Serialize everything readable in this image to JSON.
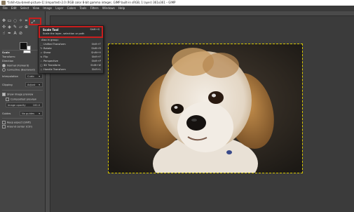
{
  "window": {
    "title": "*[shih-tzu-breed-picture-1] (imported)-2.0 (RGB color 8-bit gamma integer, GIMP built-in sRGB, 1 layer) 361x361 – GIMP"
  },
  "menubar": [
    "File",
    "Edit",
    "Select",
    "View",
    "Image",
    "Layer",
    "Colors",
    "Tools",
    "Filters",
    "Windows",
    "Help"
  ],
  "tool_popup": {
    "title": "Scale Tool",
    "shortcut": "Shift+S",
    "description": "Scale the layer, selection or path",
    "group_label": "Also in group:",
    "items": [
      {
        "icon": "unified-transform-icon",
        "label": "Unified Transform",
        "shortcut": "Shift+T"
      },
      {
        "icon": "rotate-icon",
        "label": "Rotate",
        "shortcut": "Shift+R"
      },
      {
        "icon": "shear-icon",
        "label": "Shear",
        "shortcut": "Shift+H"
      },
      {
        "icon": "flip-icon",
        "label": "Flip",
        "shortcut": "Shift+F"
      },
      {
        "icon": "perspective-icon",
        "label": "Perspective",
        "shortcut": "Shift+P"
      },
      {
        "icon": "3d-transform-icon",
        "label": "3D Transform",
        "shortcut": "Shift+W"
      },
      {
        "icon": "handle-transform-icon",
        "label": "Handle Transform",
        "shortcut": "Shift+L"
      }
    ]
  },
  "tool_options": {
    "title": "Scale",
    "transform_label": "Transform:",
    "direction_label": "Direction",
    "direction_normal": "Normal (Forward)",
    "direction_corrective": "Corrective (Backward)",
    "interpolation_label": "Interpolation",
    "interpolation_value": "Cubic",
    "clipping_label": "Clipping",
    "clipping_value": "Adjust",
    "show_preview": "Show image preview",
    "composited_preview": "Composited preview",
    "image_opacity_label": "Image opacity",
    "image_opacity_value": "100.0",
    "guides_label": "Guides",
    "guides_value": "No guides",
    "keep_aspect": "Keep aspect (Shift)",
    "around_center": "Around center (Ctrl)"
  },
  "colors": {
    "accent_red": "#c81e1e",
    "selection_border": "#d6c600",
    "canvas_bg": "#3b3b3b"
  }
}
